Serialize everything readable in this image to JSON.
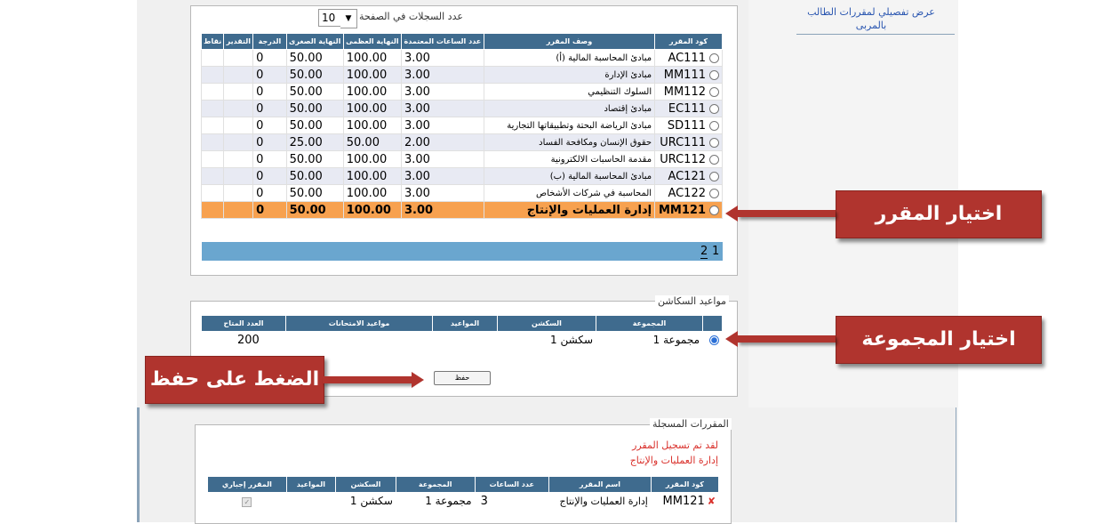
{
  "sidebar": {
    "link_text": "عرض تفصيلي لمقررات الطالب بالمربى"
  },
  "pager_top": {
    "label": "عدد السجلات في الصفحة",
    "value": "10"
  },
  "courses": {
    "headers": [
      "كود المقرر",
      "وصف المقرر",
      "عدد الساعات المعتمدة",
      "النهاية العظمى",
      "النهاية الصغرى",
      "الدرجة",
      "التقدير",
      "نقاط"
    ],
    "rows": [
      {
        "code": "AC111",
        "desc": "مبادئ المحاسبة المالية (أ)",
        "hours": "3.00",
        "max": "100.00",
        "min": "50.00",
        "grade": "0"
      },
      {
        "code": "MM111",
        "desc": "مبادئ الإدارة",
        "hours": "3.00",
        "max": "100.00",
        "min": "50.00",
        "grade": "0"
      },
      {
        "code": "MM112",
        "desc": "السلوك التنظيمي",
        "hours": "3.00",
        "max": "100.00",
        "min": "50.00",
        "grade": "0"
      },
      {
        "code": "EC111",
        "desc": "مبادئ إقتصاد",
        "hours": "3.00",
        "max": "100.00",
        "min": "50.00",
        "grade": "0"
      },
      {
        "code": "SD111",
        "desc": "مبادئ الرياضة البحتة وتطبيقاتها التجارية",
        "hours": "3.00",
        "max": "100.00",
        "min": "50.00",
        "grade": "0"
      },
      {
        "code": "URC111",
        "desc": "حقوق الإنسان ومكافحة الفساد",
        "hours": "2.00",
        "max": "50.00",
        "min": "25.00",
        "grade": "0"
      },
      {
        "code": "URC112",
        "desc": "مقدمة الحاسبات الالكترونية",
        "hours": "3.00",
        "max": "100.00",
        "min": "50.00",
        "grade": "0"
      },
      {
        "code": "AC121",
        "desc": "مبادئ المحاسبة المالية (ب)",
        "hours": "3.00",
        "max": "100.00",
        "min": "50.00",
        "grade": "0"
      },
      {
        "code": "AC122",
        "desc": "المحاسبة في شركات الأشخاص",
        "hours": "3.00",
        "max": "100.00",
        "min": "50.00",
        "grade": "0"
      },
      {
        "code": "MM121",
        "desc": "إدارة العمليات والإنتاج",
        "hours": "3.00",
        "max": "100.00",
        "min": "50.00",
        "grade": "0"
      }
    ],
    "pages": [
      "1",
      "2"
    ]
  },
  "sections": {
    "legend": "مواعيد السكاشن",
    "headers": [
      "المجموعة",
      "السكشن",
      "المواعيد",
      "مواعيد الامتحانات",
      "العدد المتاح"
    ],
    "row": {
      "group": "مجموعة 1",
      "section": "سكشن 1",
      "times": "",
      "exams": "",
      "available": "200"
    },
    "save_label": "حفظ"
  },
  "registered": {
    "legend": "المقررات المسجلة",
    "msg1": "لقد تم تسجيل المقرر",
    "msg2": "إدارة العمليات والإنتاج",
    "headers": [
      "كود المقرر",
      "اسم المقرر",
      "عدد الساعات",
      "المجموعة",
      "السكشن",
      "المواعيد",
      "المقرر إجباري"
    ],
    "row": {
      "code": "MM121",
      "name": "إدارة العمليات والإنتاج",
      "hours": "3",
      "group": "مجموعة 1",
      "section": "سكشن 1",
      "times": ""
    }
  },
  "callouts": {
    "choose_course": "اختيار المقرر",
    "choose_group": "اختيار المجموعة",
    "press_save": "الضغط على حفظ"
  },
  "colors": {
    "header": "#3f6b8e",
    "selected_row": "#f7a14f",
    "callout": "#b0342e",
    "pager_bar": "#6aa6cf"
  }
}
